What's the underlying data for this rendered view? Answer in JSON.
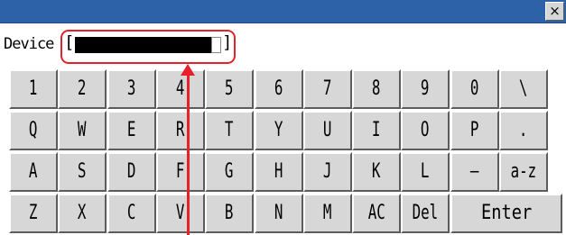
{
  "window": {
    "close_glyph": "×",
    "titlebar_color": "#2e62a8"
  },
  "device_input": {
    "label": "Device",
    "open_bracket": "[",
    "close_bracket": "]",
    "value": ""
  },
  "annotation": {
    "highlight_color": "#e8202a"
  },
  "keyboard": {
    "rows": [
      [
        "1",
        "2",
        "3",
        "4",
        "5",
        "6",
        "7",
        "8",
        "9",
        "0",
        "\\"
      ],
      [
        "Q",
        "W",
        "E",
        "R",
        "T",
        "Y",
        "U",
        "I",
        "O",
        "P",
        "."
      ],
      [
        "A",
        "S",
        "D",
        "F",
        "G",
        "H",
        "J",
        "K",
        "L",
        "—",
        "a-z"
      ],
      [
        "Z",
        "X",
        "C",
        "V",
        "B",
        "N",
        "M",
        "AC",
        "Del",
        "Enter"
      ]
    ]
  }
}
